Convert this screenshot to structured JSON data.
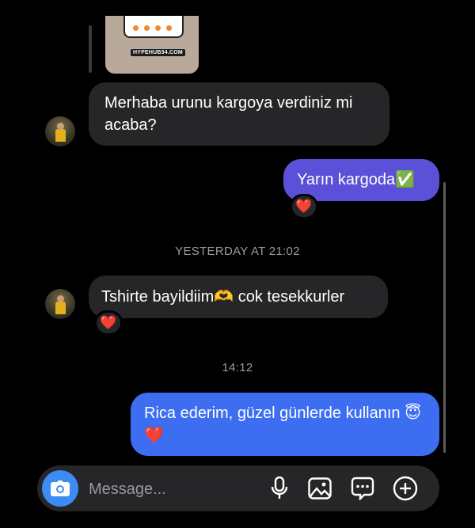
{
  "story_preview": {
    "watermark": "HYPEHUB34.COM"
  },
  "messages": [
    {
      "text": "Merhaba urunu kargoya verdiniz mi acaba?"
    },
    {
      "text": "Yarın kargoda✅",
      "reaction": "❤️"
    },
    {
      "text": "Tshirte bayildiim🫶 cok tesekkurler",
      "reaction": "❤️"
    },
    {
      "text": "Rica ederim, güzel günlerde kullanın 😇❤️"
    }
  ],
  "timestamps": [
    "YESTERDAY AT 21:02",
    "14:12"
  ],
  "composer": {
    "placeholder": "Message..."
  },
  "colors": {
    "incoming": "#262628",
    "outgoing_purple": "#5b51d8",
    "outgoing_blue": "#3d6ef2",
    "camera": "#3d8bf5"
  }
}
